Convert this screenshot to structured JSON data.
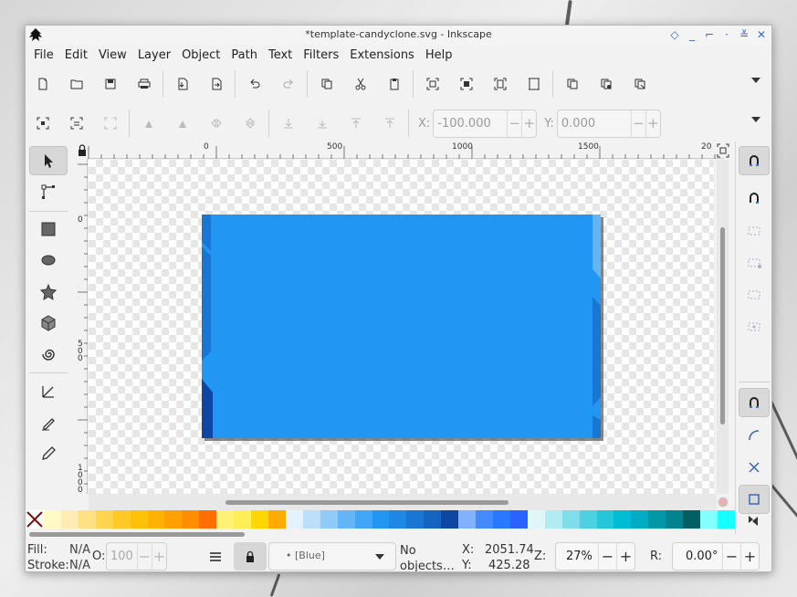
{
  "window": {
    "title": "*template-candyclone.svg - Inkscape",
    "controls": [
      "diamond-icon",
      "minimize-icon",
      "restore-icon",
      "dot-icon",
      "chevrons-icon",
      "close-icon"
    ]
  },
  "menu": [
    "File",
    "Edit",
    "View",
    "Layer",
    "Object",
    "Path",
    "Text",
    "Filters",
    "Extensions",
    "Help"
  ],
  "commands_bar": {
    "buttons": [
      "new-document-icon",
      "open-icon",
      "save-icon",
      "print-icon",
      "import-icon",
      "export-icon",
      "undo-icon",
      "redo-icon",
      "copy-icon",
      "cut-icon",
      "paste-icon",
      "zoom-selection-icon",
      "zoom-drawing-icon",
      "zoom-page-icon",
      "zoom-page-width-icon",
      "duplicate-icon",
      "clone-icon",
      "unlink-clone-icon"
    ]
  },
  "tool_controls": {
    "x_label": "X:",
    "x_value": "-100.000",
    "y_label": "Y:",
    "y_value": "0.000"
  },
  "rulers": {
    "top_labels": [
      "0",
      "500",
      "1000",
      "1500",
      "20"
    ],
    "left_labels": [
      "0",
      "5",
      "0",
      "0",
      "1",
      "0",
      "0",
      "0"
    ]
  },
  "toolbox": [
    "selector-tool",
    "node-tool",
    "rectangle-tool",
    "ellipse-tool",
    "star-tool",
    "3d-box-tool",
    "spiral-tool",
    "pen-tool",
    "calligraphy-tool",
    "pencil-tool"
  ],
  "document": {
    "background_color": "#2196f3",
    "accent_dark": "#1976d2",
    "accent_light": "#64b5f6"
  },
  "palette": {
    "colors": [
      "#fff9c4",
      "#ffecb3",
      "#ffe082",
      "#ffd54f",
      "#ffca28",
      "#ffc107",
      "#ffb300",
      "#ffa000",
      "#ff8f00",
      "#ff6f00",
      "#fff176",
      "#ffee58",
      "#ffd600",
      "#ffab00",
      "#e3f2fd",
      "#bbdefb",
      "#90caf9",
      "#64b5f6",
      "#42a5f5",
      "#2196f3",
      "#1e88e5",
      "#1976d2",
      "#1565c0",
      "#0d47a1",
      "#82b1ff",
      "#448aff",
      "#2979ff",
      "#2962ff",
      "#e0f7fa",
      "#b2ebf2",
      "#80deea",
      "#4dd0e1",
      "#26c6da",
      "#00bcd4",
      "#00acc1",
      "#0097a7",
      "#00838f",
      "#006064",
      "#84ffff",
      "#18ffff"
    ]
  },
  "status": {
    "fill_label": "Fill:",
    "fill_value": "N/A",
    "stroke_label": "Stroke:",
    "stroke_value": "N/A",
    "opacity_label": "O:",
    "opacity_value": "100",
    "layer": "• [Blue]",
    "message": "No objects…",
    "x_label": "X:",
    "x_coord": "2051.74",
    "y_label": "Y:",
    "y_coord": "425.28",
    "zoom_label": "Z:",
    "zoom_value": "27%",
    "rotation_label": "R:",
    "rotation_value": "0.00°"
  }
}
